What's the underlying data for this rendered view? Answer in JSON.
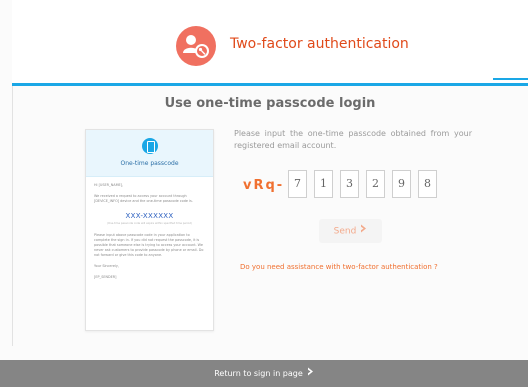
{
  "header": {
    "title": "Two-factor authentication",
    "logo_icon": "key-person-icon"
  },
  "main": {
    "title": "Use one-time passcode login",
    "instruction": "Please input the one-time passcode obtained from your registered email account.",
    "passcode_prefix": "vRq-",
    "digits": [
      "7",
      "1",
      "3",
      "2",
      "9",
      "8"
    ],
    "send_label": "Send",
    "help_link": "Do you need assistance with two-factor authentication ?"
  },
  "email_preview": {
    "header_title": "One-time passcode",
    "greeting": "Hi [USER_NAME],",
    "paragraph1": "We received a request to access your account through [DEVICE_INFO] device and the one-time passcode code is.",
    "code": "XXX-XXXXXX",
    "code_note": "(One-time passcode code will expire within specified time period)",
    "paragraph2": "Please input above passcode code in your application to complete the sign in. If you did not request the passcode, it is possible that someone else is trying to access your account. We never ask customers to provide passcode by phone or email. Do not forward or give this code to anyone.",
    "signoff": "Your Sincerely,",
    "sender": "[EP_SENDER]"
  },
  "footer": {
    "link": "Return to sign in page"
  },
  "colors": {
    "accent": "#f07030",
    "header_title": "#e04a1a",
    "divider": "#1aa7e6",
    "footer": "#858585"
  }
}
